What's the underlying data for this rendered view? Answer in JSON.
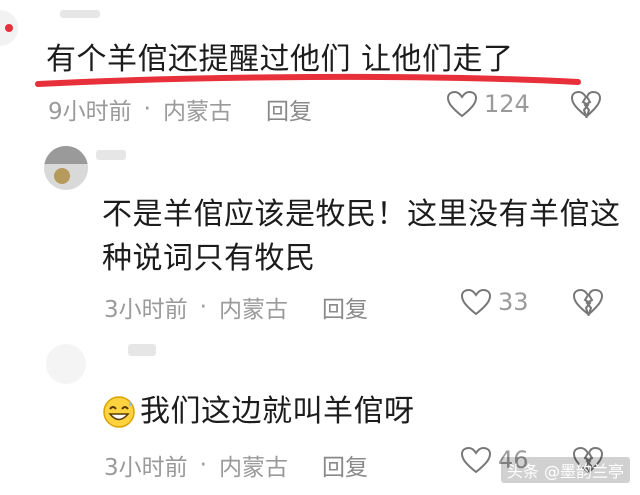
{
  "comments": [
    {
      "text": "有个羊倌还提醒过他们 让他们走了",
      "time": "9小时前",
      "location": "内蒙古",
      "reply_label": "回复",
      "likes": "124"
    },
    {
      "text_line1": "不是羊倌应该是牧民！这里没有羊倌这",
      "text_line2": "种说词只有牧民",
      "time": "3小时前",
      "location": "内蒙古",
      "reply_label": "回复",
      "likes": "33"
    },
    {
      "emoji": "grinning-sweat-emoji",
      "text": "我们这边就叫羊倌呀",
      "time": "3小时前",
      "location": "内蒙古",
      "reply_label": "回复",
      "likes": "46"
    }
  ],
  "separator": "·",
  "watermark": "头条 @墨韵兰亭",
  "colors": {
    "accent_red": "#e8303a",
    "meta_gray": "#9a9a9a"
  }
}
